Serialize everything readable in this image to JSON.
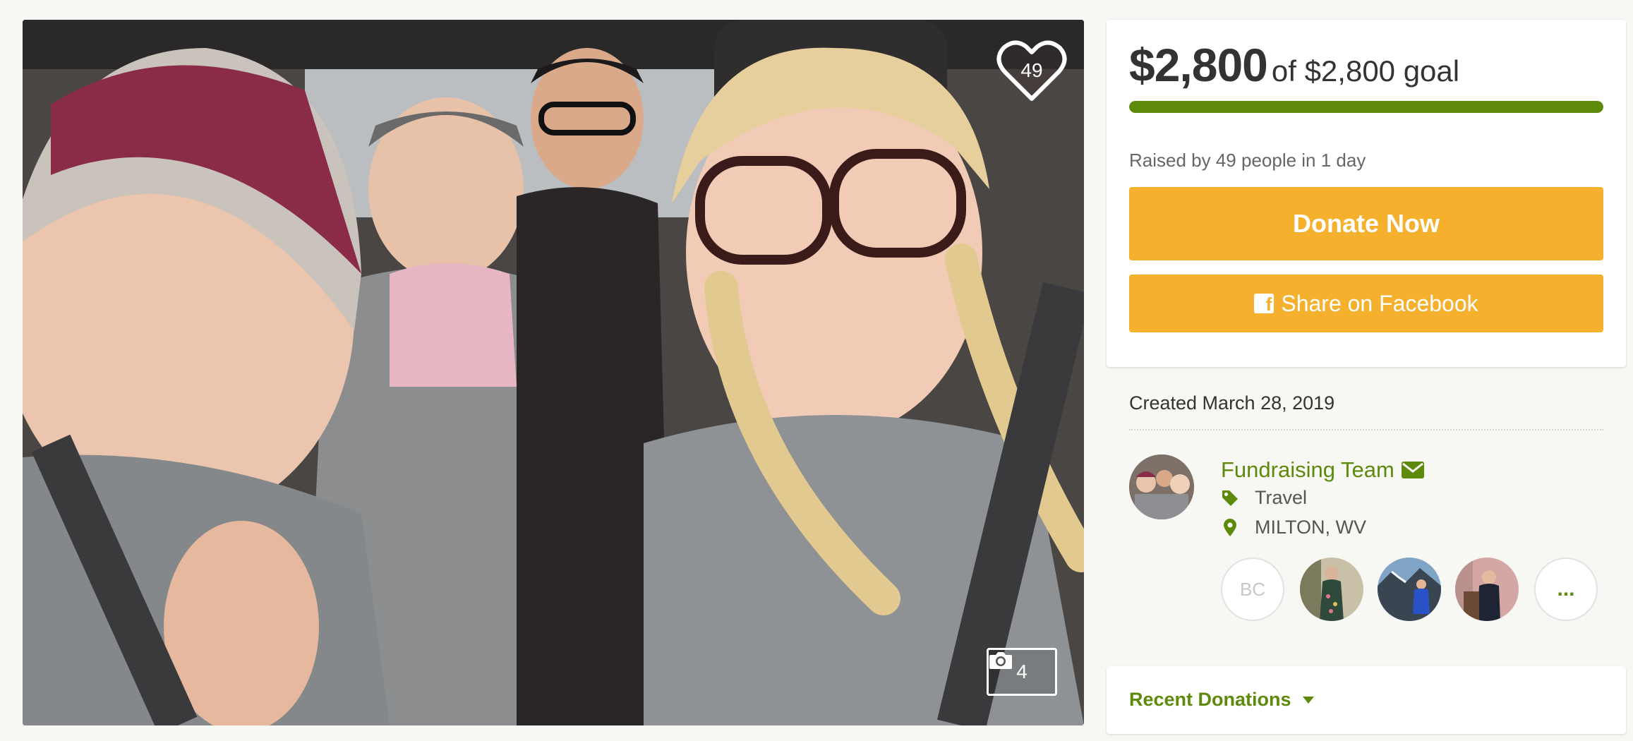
{
  "hero": {
    "like_count": "49",
    "photo_count": "4"
  },
  "donation": {
    "raised": "$2,800",
    "goal_text": "of $2,800 goal",
    "progress_fraction": 1.0,
    "raised_by": "Raised by 49 people in 1 day",
    "donate_label": "Donate Now",
    "share_label": "Share on Facebook"
  },
  "details": {
    "created": "Created March 28, 2019",
    "team_name": "Fundraising Team",
    "category": "Travel",
    "location": "MILTON, WV",
    "members": [
      {
        "initials": "BC"
      },
      {
        "more": "..."
      }
    ]
  },
  "recent": {
    "label": "Recent Donations"
  },
  "colors": {
    "accent_green": "#5e8a0c",
    "button_yellow": "#f5b02e"
  }
}
